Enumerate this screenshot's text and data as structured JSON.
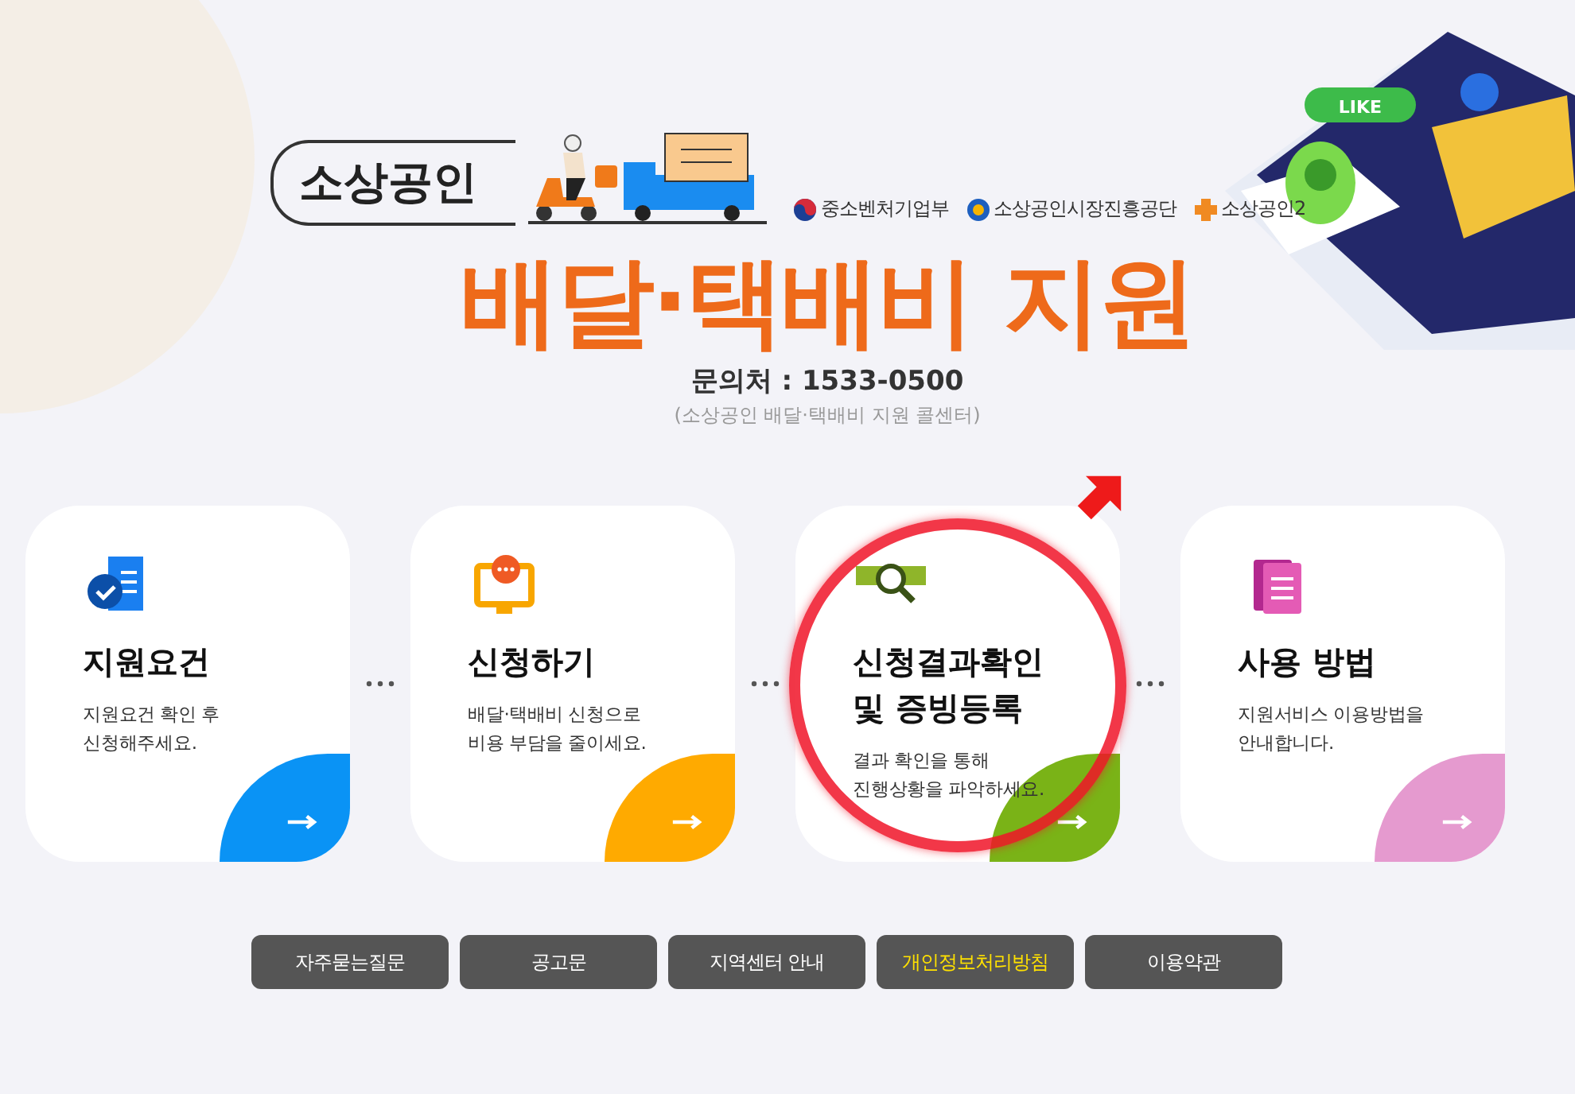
{
  "brand": {
    "label": "소상공인"
  },
  "agencies": [
    {
      "name": "중소벤처기업부",
      "kind": "taegeuk"
    },
    {
      "name": "소상공인시장진흥공단",
      "kind": "semas"
    },
    {
      "name": "소상공인2",
      "kind": "plus"
    }
  ],
  "illustration": {
    "badge": "LIKE"
  },
  "title": "배달·택배비 지원",
  "contact": {
    "label": "문의처 : 1533-0500",
    "note": "(소상공인 배달·택배비 지원 콜센터)"
  },
  "cards": [
    {
      "title": "지원요건",
      "desc": [
        "지원요건 확인 후",
        "신청해주세요."
      ],
      "kind": "document",
      "color": "#0a93f5",
      "highlighted": false
    },
    {
      "title": "신청하기",
      "desc": [
        "배달·택배비 신청으로",
        "비용 부담을 줄이세요."
      ],
      "kind": "monitor",
      "color": "#ffaa00",
      "highlighted": false
    },
    {
      "title": "신청결과확인\n및 증빙등록",
      "desc": [
        "결과 확인을 통해",
        "진행상황을 파악하세요."
      ],
      "kind": "search",
      "color": "#7ab317",
      "highlighted": true
    },
    {
      "title": "사용 방법",
      "desc": [
        "지원서비스 이용방법을",
        "안내합니다."
      ],
      "kind": "pages",
      "color": "#e59acf",
      "highlighted": false
    }
  ],
  "links": [
    {
      "label": "자주묻는질문",
      "emphasized": false
    },
    {
      "label": "공고문",
      "emphasized": false
    },
    {
      "label": "지역센터 안내",
      "emphasized": false
    },
    {
      "label": "개인정보처리방침",
      "emphasized": true
    },
    {
      "label": "이용약관",
      "emphasized": false
    }
  ]
}
